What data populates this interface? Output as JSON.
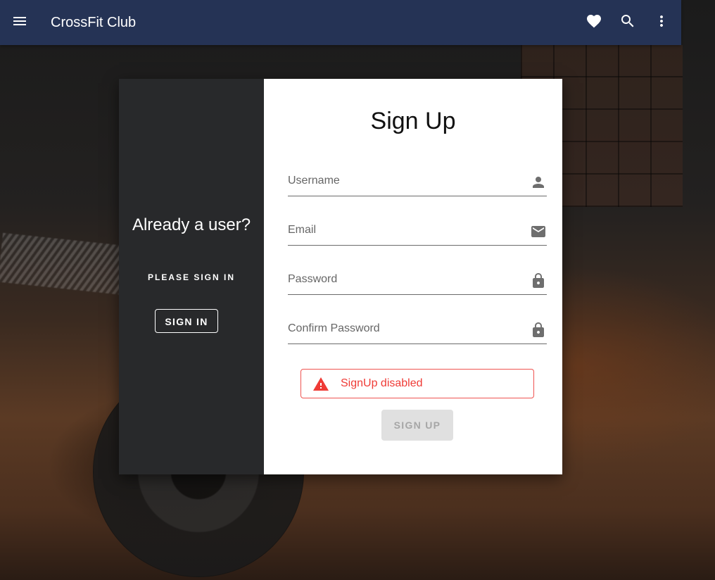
{
  "app": {
    "title": "CrossFit Club"
  },
  "toolbar": {
    "menu_icon": "menu-icon",
    "favorite_icon": "heart-icon",
    "search_icon": "search-icon",
    "more_icon": "more-vert-icon"
  },
  "left_panel": {
    "heading": "Already a user?",
    "subheading": "PLEASE SIGN IN",
    "sign_in_label": "SIGN IN"
  },
  "form": {
    "title": "Sign Up",
    "fields": [
      {
        "label": "Username",
        "value": "",
        "icon": "person-icon"
      },
      {
        "label": "Email",
        "value": "",
        "icon": "email-icon"
      },
      {
        "label": "Password",
        "value": "",
        "icon": "lock-icon"
      },
      {
        "label": "Confirm Password",
        "value": "",
        "icon": "lock-icon"
      }
    ],
    "alert": {
      "icon": "warning-icon",
      "text": "SignUp disabled"
    },
    "submit_label": "SIGN UP",
    "submit_disabled": true
  },
  "colors": {
    "appbar": "#253355",
    "left_panel": "#28292b",
    "alert": "#ef3b36",
    "disabled_button": "#e0e0e0"
  }
}
